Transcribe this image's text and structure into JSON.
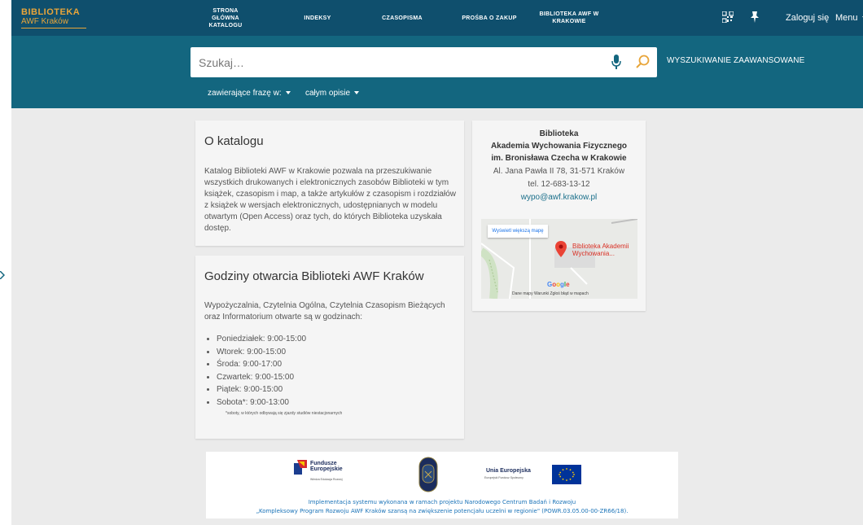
{
  "header": {
    "logo_line1": "BIBLIOTEKA",
    "logo_line2": "AWF Kraków",
    "nav": [
      {
        "label": "STRONA GŁÓWNA KATALOGU"
      },
      {
        "label": "INDEKSY"
      },
      {
        "label": "CZASOPISMA"
      },
      {
        "label": "PROŚBA O ZAKUP"
      },
      {
        "label": "BIBLIOTEKA AWF W KRAKOWIE"
      }
    ],
    "login": "Zaloguj się",
    "menu": "Menu"
  },
  "search": {
    "placeholder": "Szukaj…",
    "advanced": "WYSZUKIWANIE ZAAWANSOWANE",
    "filter_mode": "zawierające frazę w:",
    "filter_field": "całym opisie"
  },
  "about": {
    "title": "O katalogu",
    "text": "Katalog Biblioteki AWF w Krakowie pozwala na przeszukiwanie wszystkich drukowanych i elektronicznych zasobów Biblioteki w tym książek, czasopism i map, a także artykułów z czasopism i rozdziałów z książek w wersjach elektronicznych, udostępnianych w modelu otwartym (Open Access) oraz tych, do których Biblioteka uzyskała dostęp."
  },
  "hours": {
    "title": "Godziny otwarcia Biblioteki AWF Kraków",
    "intro": "Wypożyczalnia, Czytelnia Ogólna, Czytelnia Czasopism Bieżących oraz Informatorium otwarte są w godzinach:",
    "days": [
      "Poniedziałek: 9:00-15:00",
      "Wtorek: 9:00-15:00",
      "Środa: 9:00-17:00",
      "Czwartek: 9:00-15:00",
      "Piątek: 9:00-15:00",
      "Sobota*: 9:00-13:00"
    ],
    "note": "*soboty, w których odbywają się zjazdy studiów niestacjonarnych"
  },
  "library": {
    "line1": "Biblioteka",
    "line2": "Akademia Wychowania Fizycznego",
    "line3": "im. Bronisława Czecha w Krakowie",
    "address": "Al. Jana Pawła II 78, 31-571 Kraków",
    "phone": "tel. 12-683-13-12",
    "email": "wypo@awf.krakow.pl"
  },
  "map": {
    "button": "Wyświetl większą mapę",
    "marker_label_1": "Biblioteka Akademii",
    "marker_label_2": "Wychowania...",
    "google": "Google",
    "footer": "Dane mapy   Warunki   Zgłoś błąd w mapach"
  },
  "banner": {
    "fe_line1": "Fundusze",
    "fe_line2": "Europejskie",
    "fe_sub": "Wiedza Edukacja Rozwój",
    "ue_title": "Unia Europejska",
    "ue_sub": "Europejski Fundusz Społeczny",
    "line1": "Implementacja systemu wykonana w ramach projektu Narodowego Centrum Badań i Rozwoju",
    "line2": "„Kompleksowy Program Rozwoju AWF Kraków szansą na zwiększenie potencjału uczelni w regionie\" (POWR.03.05.00-00-ZR66/18)."
  },
  "colors": {
    "nav_bg": "#0f4f6d",
    "band_bg": "#13667f",
    "logo": "#e8a53a",
    "search_accent": "#e8a53a"
  }
}
